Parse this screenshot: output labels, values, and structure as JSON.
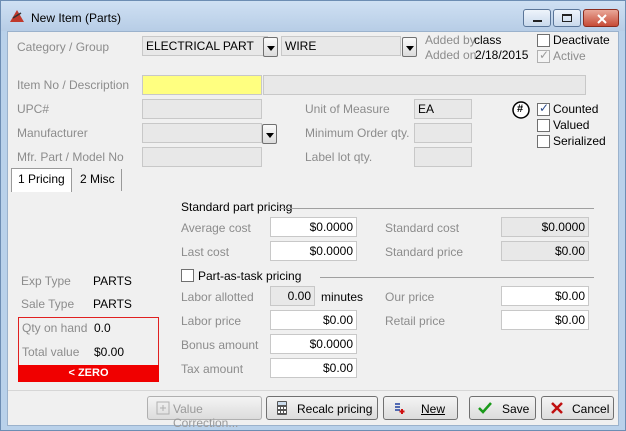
{
  "window": {
    "title": "New Item (Parts)"
  },
  "header": {
    "category_label": "Category / Group",
    "category_value": "ELECTRICAL PART",
    "group_value": "WIRE",
    "added_by_label": "Added by",
    "added_by_value": "class",
    "added_on_label": "Added on",
    "added_on_value": "2/18/2015",
    "deactivate_label": "Deactivate",
    "active_label": "Active"
  },
  "item": {
    "itemno_label": "Item No / Description",
    "upc_label": "UPC#",
    "manufacturer_label": "Manufacturer",
    "mfr_part_label": "Mfr. Part / Model No",
    "uom_label": "Unit of Measure",
    "uom_value": "EA",
    "min_order_label": "Minimum Order qty.",
    "label_lot_label": "Label lot qty.",
    "hash_icon": "#",
    "counted_label": "Counted",
    "valued_label": "Valued",
    "serialized_label": "Serialized"
  },
  "tabs": [
    {
      "label": "1 Pricing"
    },
    {
      "label": "2 Misc"
    }
  ],
  "pricing": {
    "standard_header": "Standard part pricing",
    "average_cost_label": "Average cost",
    "average_cost_value": "$0.0000",
    "last_cost_label": "Last cost",
    "last_cost_value": "$0.0000",
    "standard_cost_label": "Standard cost",
    "standard_cost_value": "$0.0000",
    "standard_price_label": "Standard price",
    "standard_price_value": "$0.00",
    "part_as_task_label": "Part-as-task pricing",
    "labor_allotted_label": "Labor allotted",
    "labor_allotted_value": "0.00",
    "minutes_label": "minutes",
    "labor_price_label": "Labor price",
    "labor_price_value": "$0.00",
    "bonus_amount_label": "Bonus amount",
    "bonus_amount_value": "$0.0000",
    "tax_amount_label": "Tax amount",
    "tax_amount_value": "$0.00",
    "our_price_label": "Our price",
    "our_price_value": "$0.00",
    "retail_price_label": "Retail price",
    "retail_price_value": "$0.00"
  },
  "left": {
    "exp_type_label": "Exp Type",
    "exp_type_value": "PARTS",
    "sale_type_label": "Sale Type",
    "sale_type_value": "PARTS",
    "qty_on_hand_label": "Qty on hand",
    "qty_on_hand_value": "0.0",
    "total_value_label": "Total value",
    "total_value_value": "$0.00",
    "zero_badge": "< ZERO"
  },
  "buttons": {
    "value_correction": "Value Correction...",
    "recalc": "Recalc pricing",
    "new": "New",
    "save": "Save",
    "cancel": "Cancel"
  },
  "colors": {
    "accent_yellow": "#ffff80",
    "zero_red": "#f00000"
  }
}
